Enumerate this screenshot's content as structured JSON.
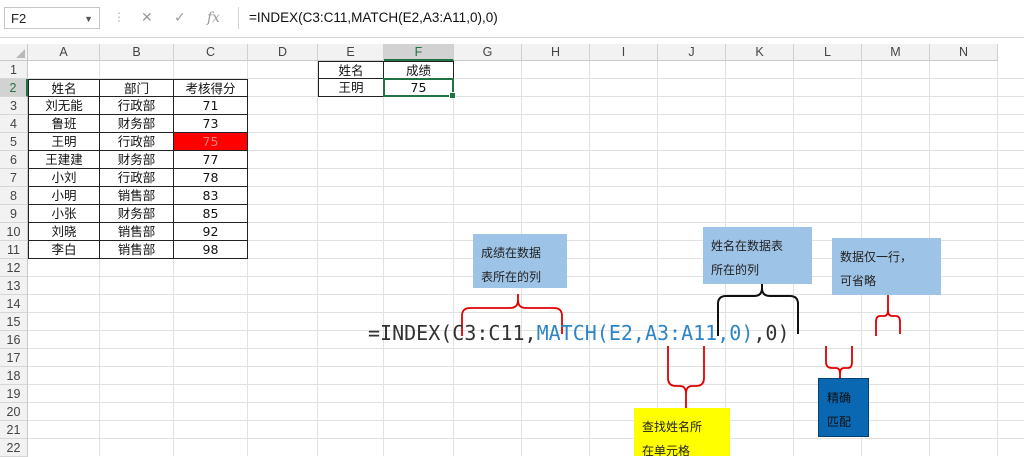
{
  "formula_bar": {
    "name_box": "F2",
    "cancel_glyph": "✕",
    "enter_glyph": "✓",
    "fx_label": "fx",
    "formula": "=INDEX(C3:C11,MATCH(E2,A3:A11,0),0)"
  },
  "sheet": {
    "columns": [
      "A",
      "B",
      "C",
      "D",
      "E",
      "F",
      "G",
      "H",
      "I",
      "J",
      "K",
      "L",
      "M",
      "N"
    ],
    "rows": [
      "1",
      "2",
      "3",
      "4",
      "5",
      "6",
      "7",
      "8",
      "9",
      "10",
      "11",
      "12",
      "13",
      "14",
      "15",
      "16",
      "17",
      "18",
      "19",
      "20",
      "21",
      "22"
    ],
    "selected_cell": "F2",
    "headers": [
      "姓名",
      "部门",
      "考核得分"
    ],
    "records": [
      [
        "刘无能",
        "行政部",
        "71"
      ],
      [
        "鲁班",
        "财务部",
        "73"
      ],
      [
        "王明",
        "行政部",
        "75"
      ],
      [
        "王建建",
        "财务部",
        "77"
      ],
      [
        "小刘",
        "行政部",
        "78"
      ],
      [
        "小明",
        "销售部",
        "83"
      ],
      [
        "小张",
        "财务部",
        "85"
      ],
      [
        "刘晓",
        "销售部",
        "92"
      ],
      [
        "李白",
        "销售部",
        "98"
      ]
    ],
    "highlight_fill": "#ff0000",
    "lookup": {
      "name_header": "姓名",
      "score_header": "成绩",
      "name_value": "王明",
      "score_value": "75"
    }
  },
  "annotation": {
    "formula_parts": {
      "p1": "=INDEX(",
      "p2": "C3:C11",
      "p3": ",",
      "p4": "MATCH(",
      "p5": "E2,A3:A11",
      "p6": ",",
      "p7": "0",
      "p8": ")",
      "p9": ",",
      "p10": "0",
      "p11": ")"
    },
    "callouts": {
      "result_column": "成绩在数据\n表所在的列",
      "name_column": "姓名在数据表\n所在的列",
      "single_row": "数据仅一行，\n可省略",
      "find_cell": "查找姓名所\n在单元格",
      "exact_match": "精确\n匹配"
    },
    "colors": {
      "index_text": "#333333",
      "match_text": "#2e85c6",
      "bracket_red": "#e00000",
      "bracket_black": "#111111",
      "box_blue": "#9dc3e6",
      "box_yellow": "#ffff00",
      "box_darkblue": "#0a67b2"
    }
  }
}
